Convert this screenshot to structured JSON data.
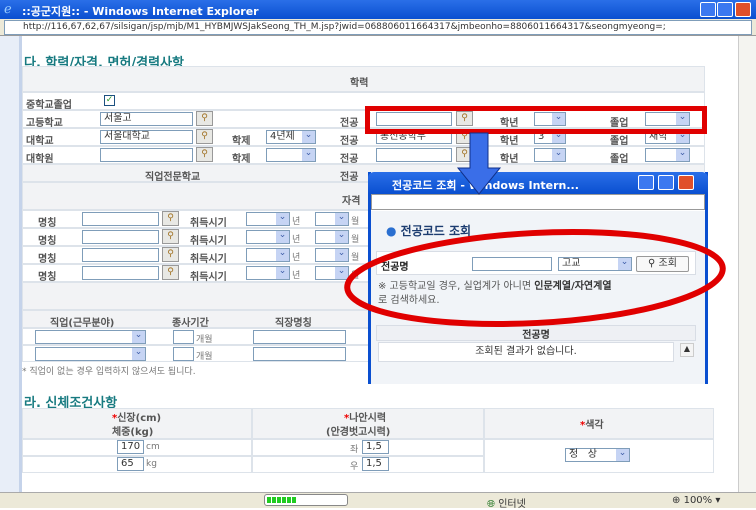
{
  "window": {
    "title": "::공군지원:: - Windows Internet Explorer",
    "url": "http://116,67,62,67/silsigan/jsp/mjb/M1_HYBMJWSJakSeong_TH_M.jsp?jwid=068806011664317&jmbeonho=8806011664317&seongmyeong=;"
  },
  "section_c": {
    "title": "다. 학력/자격, 면허/경력사항",
    "education_header": "학력",
    "middle_school": {
      "label": "중학교졸업",
      "checked": true
    },
    "rows": [
      {
        "label": "고등학교",
        "value": "서울고",
        "system_label": "",
        "system": "",
        "major_label": "전공",
        "major": "",
        "year_label": "학년",
        "year": "",
        "grad_label": "졸업",
        "grad": ""
      },
      {
        "label": "대학교",
        "value": "서울대학교",
        "system_label": "학제",
        "system": "4년제",
        "major_label": "전공",
        "major": "통신공학부",
        "year_label": "학년",
        "year": "3",
        "grad_label": "졸업",
        "grad": "재학"
      },
      {
        "label": "대학원",
        "value": "",
        "system_label": "학제",
        "system": "",
        "major_label": "전공",
        "major": "",
        "year_label": "학년",
        "year": "",
        "grad_label": "졸업",
        "grad": ""
      }
    ],
    "vocational_label": "직업전문학교",
    "vocational_major_label": "전공",
    "cert_header": "자격",
    "certs": [
      {
        "label": "명칭",
        "acq_label": "취득시기",
        "year_unit": "년",
        "month_unit": "월"
      },
      {
        "label": "명칭",
        "acq_label": "취득시기",
        "year_unit": "년",
        "month_unit": "월"
      },
      {
        "label": "명칭",
        "acq_label": "취득시기",
        "year_unit": "년",
        "month_unit": "월"
      },
      {
        "label": "명칭",
        "acq_label": "취득시기",
        "year_unit": "년",
        "month_unit": "월"
      }
    ],
    "career_headers": [
      "직업(근무분야)",
      "종사기간",
      "직장명칭"
    ],
    "career_unit": "개월",
    "career_note": "* 직업이 없는 경우 입력하지 않으셔도 됩니다."
  },
  "section_d": {
    "title": "라. 신체조건사항",
    "h1a": "신장(cm)",
    "h1b": "체중(kg)",
    "h2a": "나안시력",
    "h2b": "(안경벗고시력)",
    "h3": "색각",
    "height": "170",
    "height_unit": "cm",
    "weight": "65",
    "weight_unit": "kg",
    "left_label": "좌",
    "left": "1,5",
    "right_label": "우",
    "right": "1,5",
    "color_vision": "정   상"
  },
  "popup": {
    "title": "전공코드 조회 - Windows Intern...",
    "heading": "전공코드 조회",
    "field_label": "전공명",
    "field_value": "",
    "type": "고교",
    "search_button": "조회",
    "note_a": "※ 고등학교일 경우, 실업계가 아니면 ",
    "note_b": "인문계열/자연계열",
    "note_c": "로 검색하세요.",
    "col_header": "전공명",
    "empty": "조회된 결과가 없습니다."
  },
  "statusbar": {
    "zone": "인터넷",
    "zoom": "100%",
    "progress": 1.0
  },
  "colors": {
    "annotation": "#e00000",
    "arrow": "#3a6ee8"
  }
}
